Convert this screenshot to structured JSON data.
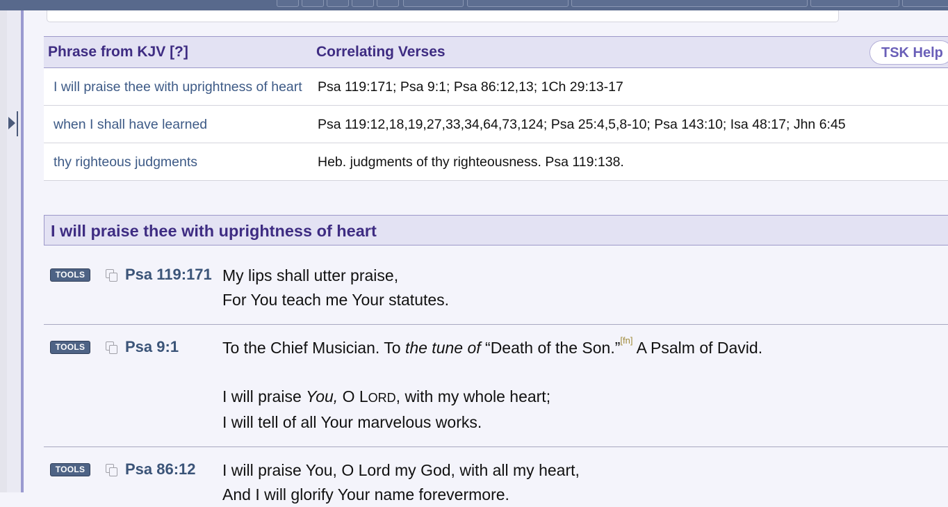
{
  "tsk_table": {
    "col_phrase": "Phrase from KJV  [?]",
    "col_verses": "Correlating Verses",
    "help_button": "TSK Help",
    "rows": [
      {
        "phrase": "I will praise thee with uprightness of heart",
        "verses": "Psa 119:171; Psa 9:1; Psa 86:12,13; 1Ch 29:13-17"
      },
      {
        "phrase": "when I shall have learned",
        "verses": "Psa 119:12,18,19,27,33,34,64,73,124; Psa 25:4,5,8-10; Psa 143:10; Isa 48:17; Jhn 6:45"
      },
      {
        "phrase": "thy righteous judgments",
        "verses": "Heb. judgments of thy righteousness. Psa 119:138."
      }
    ]
  },
  "section": {
    "title": "I will praise thee with uprightness of heart"
  },
  "tools_label": "TOOLS",
  "verses": [
    {
      "ref": "Psa 119:171",
      "line1": "My lips shall utter praise,",
      "line2": "For You teach me Your statutes."
    },
    {
      "ref": "Psa 9:1",
      "heading_a": "To the Chief Musician. To ",
      "heading_italic": "the tune of",
      "heading_b": " “Death of the Son.”",
      "footnote": "[fn]",
      "heading_c": " A Psalm of David.",
      "line1_a": "I will praise ",
      "line1_italic": "You,",
      "line1_b": " O L",
      "line1_sc": "ORD",
      "line1_c": ", with my whole heart;",
      "line2": "I will tell of all Your marvelous works."
    },
    {
      "ref": "Psa 86:12",
      "line1": "I will praise You, O Lord my God, with all my heart,",
      "line2": "And I will glorify Your name forevermore."
    }
  ]
}
